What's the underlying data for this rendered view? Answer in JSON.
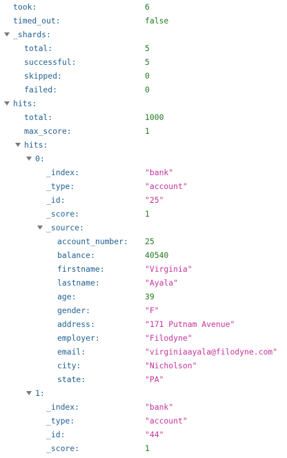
{
  "json_viewer": {
    "rows": [
      {
        "indent": 0,
        "key": "took:",
        "value": "6",
        "type": "num"
      },
      {
        "indent": 0,
        "key": "timed_out:",
        "value": "false",
        "type": "bool"
      },
      {
        "indent": 0,
        "key": "_shards:",
        "expanded": true
      },
      {
        "indent": 1,
        "key": "total:",
        "value": "5",
        "type": "num"
      },
      {
        "indent": 1,
        "key": "successful:",
        "value": "5",
        "type": "num"
      },
      {
        "indent": 1,
        "key": "skipped:",
        "value": "0",
        "type": "num"
      },
      {
        "indent": 1,
        "key": "failed:",
        "value": "0",
        "type": "num"
      },
      {
        "indent": 0,
        "key": "hits:",
        "expanded": true
      },
      {
        "indent": 1,
        "key": "total:",
        "value": "1000",
        "type": "num"
      },
      {
        "indent": 1,
        "key": "max_score:",
        "value": "1",
        "type": "num"
      },
      {
        "indent": 1,
        "key": "hits:",
        "expanded": true
      },
      {
        "indent": 2,
        "key": "0:",
        "expanded": true
      },
      {
        "indent": 3,
        "key": "_index:",
        "value": "\"bank\"",
        "type": "str"
      },
      {
        "indent": 3,
        "key": "_type:",
        "value": "\"account\"",
        "type": "str"
      },
      {
        "indent": 3,
        "key": "_id:",
        "value": "\"25\"",
        "type": "str"
      },
      {
        "indent": 3,
        "key": "_score:",
        "value": "1",
        "type": "num"
      },
      {
        "indent": 3,
        "key": "_source:",
        "expanded": true
      },
      {
        "indent": 4,
        "key": "account_number:",
        "value": "25",
        "type": "num"
      },
      {
        "indent": 4,
        "key": "balance:",
        "value": "40540",
        "type": "num"
      },
      {
        "indent": 4,
        "key": "firstname:",
        "value": "\"Virginia\"",
        "type": "str"
      },
      {
        "indent": 4,
        "key": "lastname:",
        "value": "\"Ayala\"",
        "type": "str"
      },
      {
        "indent": 4,
        "key": "age:",
        "value": "39",
        "type": "num"
      },
      {
        "indent": 4,
        "key": "gender:",
        "value": "\"F\"",
        "type": "str"
      },
      {
        "indent": 4,
        "key": "address:",
        "value": "\"171 Putnam Avenue\"",
        "type": "str"
      },
      {
        "indent": 4,
        "key": "employer:",
        "value": "\"Filodyne\"",
        "type": "str"
      },
      {
        "indent": 4,
        "key": "email:",
        "value": "\"virginiaayala@filodyne.com\"",
        "type": "str"
      },
      {
        "indent": 4,
        "key": "city:",
        "value": "\"Nicholson\"",
        "type": "str"
      },
      {
        "indent": 4,
        "key": "state:",
        "value": "\"PA\"",
        "type": "str"
      },
      {
        "indent": 2,
        "key": "1:",
        "expanded": true
      },
      {
        "indent": 3,
        "key": "_index:",
        "value": "\"bank\"",
        "type": "str"
      },
      {
        "indent": 3,
        "key": "_type:",
        "value": "\"account\"",
        "type": "str"
      },
      {
        "indent": 3,
        "key": "_id:",
        "value": "\"44\"",
        "type": "str"
      },
      {
        "indent": 3,
        "key": "_score:",
        "value": "1",
        "type": "num"
      }
    ]
  },
  "colors": {
    "key": "#1f5f91",
    "number": "#1f7a1f",
    "string": "#c5339b",
    "toggle": "#7a7a7a",
    "background": "#ffffff"
  }
}
